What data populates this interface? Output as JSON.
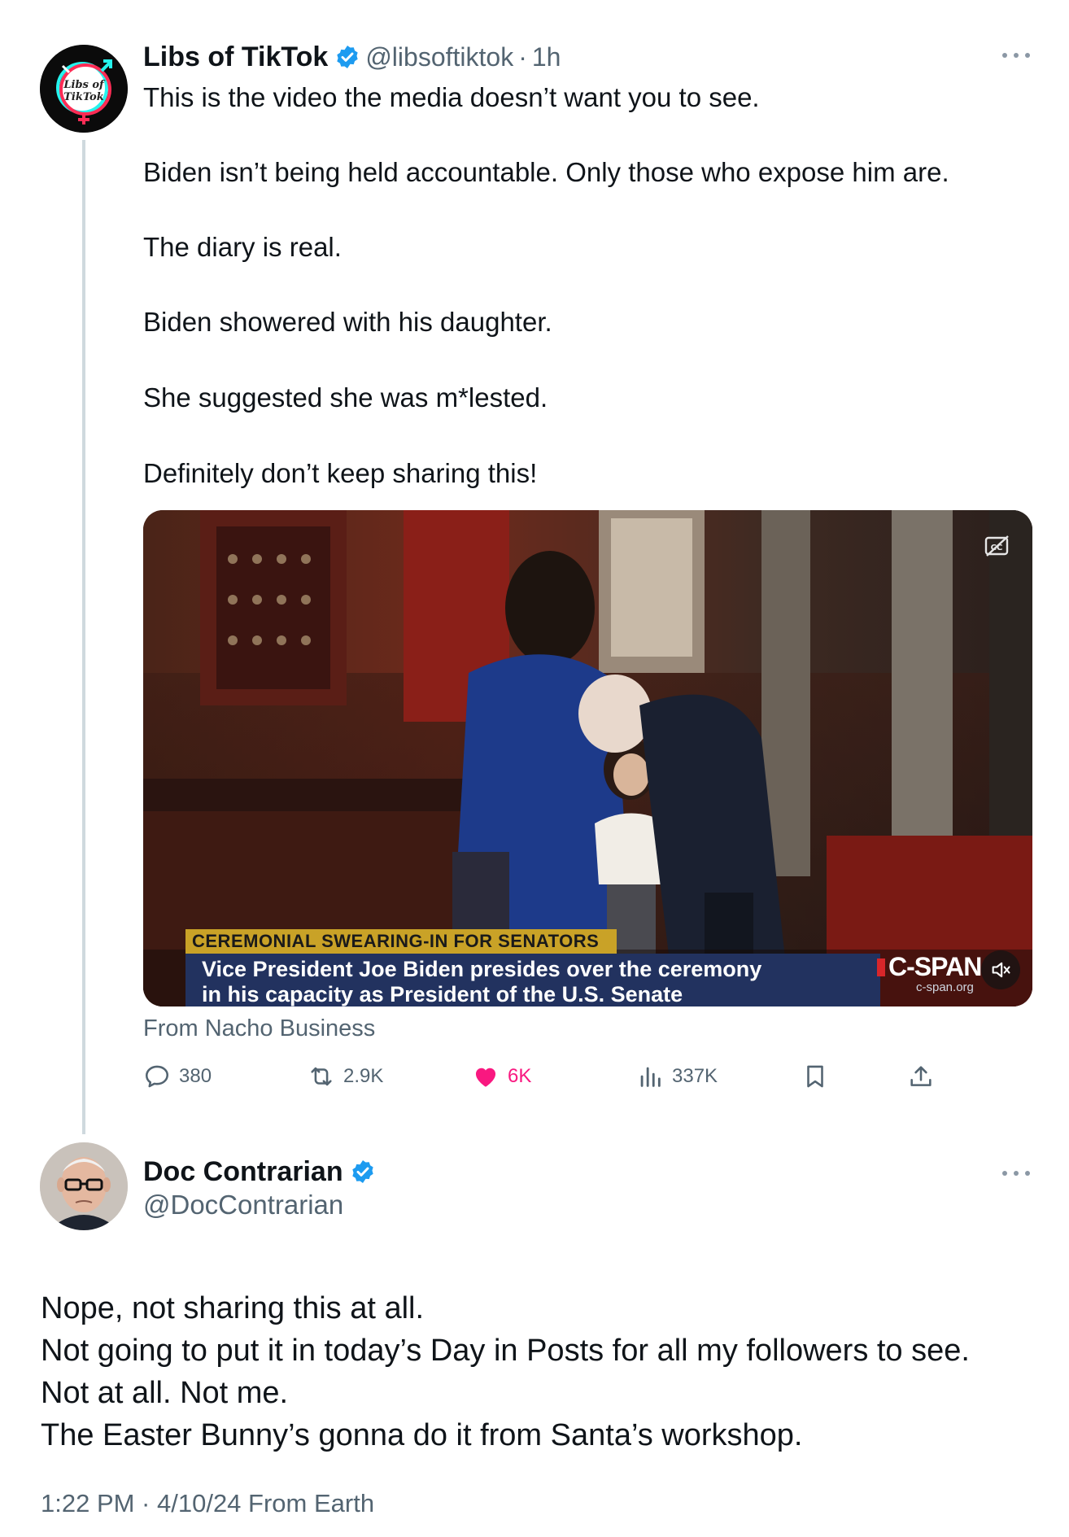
{
  "colors": {
    "text": "#0f1419",
    "secondary": "#536471",
    "verified": "#1d9bf0",
    "like": "#f91880",
    "thread_line": "#cfd9de"
  },
  "tweet1": {
    "display_name": "Libs of TikTok",
    "handle": "@libsoftiktok",
    "separator": "·",
    "time": "1h",
    "avatar_text_1": "Libs of",
    "avatar_text_2": "TikTok",
    "lines": [
      "This is the video the media doesn’t want you to see.",
      "Biden isn’t being held accountable. Only those who expose him are.",
      "The diary is real.",
      "Biden showered with his daughter.",
      "She suggested she was m*lested.",
      "Definitely don’t keep sharing this!"
    ],
    "media": {
      "banner_title": "CEREMONIAL SWEARING-IN FOR SENATORS",
      "banner_line1": "Vice President Joe Biden presides over the ceremony",
      "banner_line2": "in his capacity as President of the U.S. Senate",
      "network_logo": "C-SPAN",
      "network_url": "c-span.org",
      "captions_icon": "closed-captions-off-icon",
      "sound_icon": "speaker-muted-icon"
    },
    "source": "From Nacho Business",
    "actions": {
      "replies": "380",
      "reposts": "2.9K",
      "likes": "6K",
      "views": "337K"
    }
  },
  "tweet2": {
    "display_name": "Doc Contrarian",
    "handle": "@DocContrarian",
    "lines": [
      "Nope, not sharing this at all.",
      "Not going to put it in today’s Day in Posts for all my followers to see.",
      "Not at all. Not me.",
      "The Easter Bunny’s gonna do it from Santa’s workshop."
    ],
    "timestamp": "1:22 PM · 4/10/24 From Earth"
  }
}
